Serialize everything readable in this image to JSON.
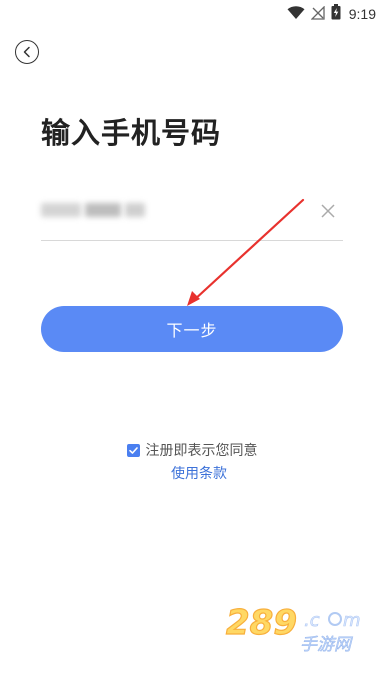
{
  "status_bar": {
    "time": "9:19",
    "icons": [
      "wifi-icon",
      "no-signal-icon",
      "battery-charging-icon"
    ]
  },
  "header": {
    "back_icon": "chevron-left-icon"
  },
  "page": {
    "title": "输入手机号码"
  },
  "phone_input": {
    "value": "",
    "clear_icon": "close-icon"
  },
  "actions": {
    "next_label": "下一步"
  },
  "agreement": {
    "checked": true,
    "text": "注册即表示您同意",
    "terms_link": "使用条款"
  },
  "watermark": {
    "brand": "289.com",
    "subtitle": "手游网"
  },
  "colors": {
    "primary": "#5a8af5",
    "link": "#3d72d9",
    "arrow": "#e8322e",
    "checkbox": "#4a7ff0"
  }
}
